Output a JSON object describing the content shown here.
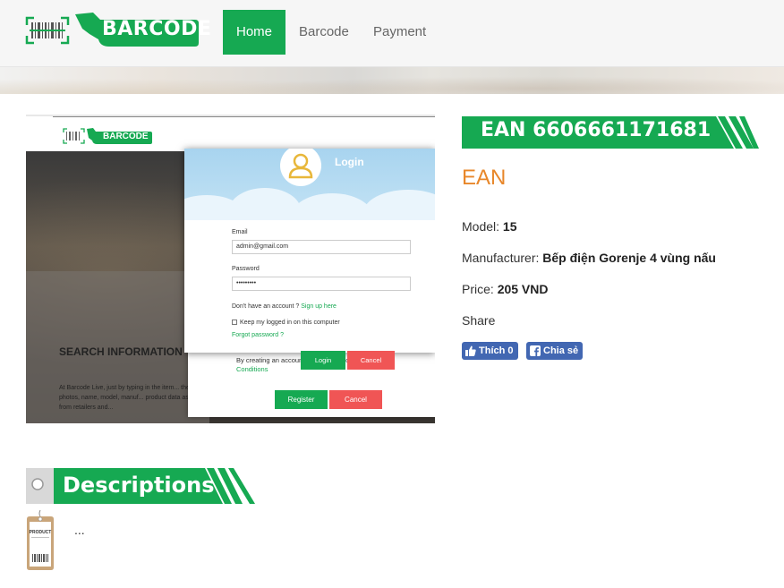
{
  "brand": {
    "name": "BARCODE"
  },
  "nav": {
    "items": [
      "Home",
      "Barcode",
      "Payment"
    ],
    "active": "Home"
  },
  "colors": {
    "brand_green": "#16a952",
    "orange": "#e8872a",
    "facebook": "#4267b2",
    "red": "#f05555"
  },
  "screenshot": {
    "brand": "BARCODE",
    "login": {
      "title": "Login",
      "email_label": "Email",
      "email_value": "admin@gmail.com",
      "password_label": "Password",
      "password_value": "•••••••••",
      "no_account": "Don't have an account ?",
      "signup_link": "Sign up here",
      "keep_logged": "Keep my logged in on this computer",
      "forgot": "Forgot password ?",
      "login_btn": "Login",
      "cancel_btn": "Cancel"
    },
    "register": {
      "note_prefix": "By creating an account you agree to our",
      "terms_link": "Terms and Conditions",
      "register_btn": "Register",
      "cancel_btn": "Cancel"
    },
    "search_heading": "SEARCH INFORMATION",
    "search_para": "At Barcode Live, just by typing in the item... the world: photos, name, model, manuf... product data as well as from retailers and..."
  },
  "product": {
    "ean_title": "EAN 6606661171681",
    "code_type": "EAN",
    "model_label": "Model:",
    "model_value": "15",
    "manufacturer_label": "Manufacturer:",
    "manufacturer_value": "Bếp điện Gorenje 4 vùng nấu",
    "price_label": "Price:",
    "price_value": "205 VND",
    "share_label": "Share",
    "like_btn": "Thích 0",
    "share_btn": "Chia sẻ"
  },
  "descriptions": {
    "title": "Descriptions",
    "tag_label": "PRODUCT",
    "body": "..."
  }
}
